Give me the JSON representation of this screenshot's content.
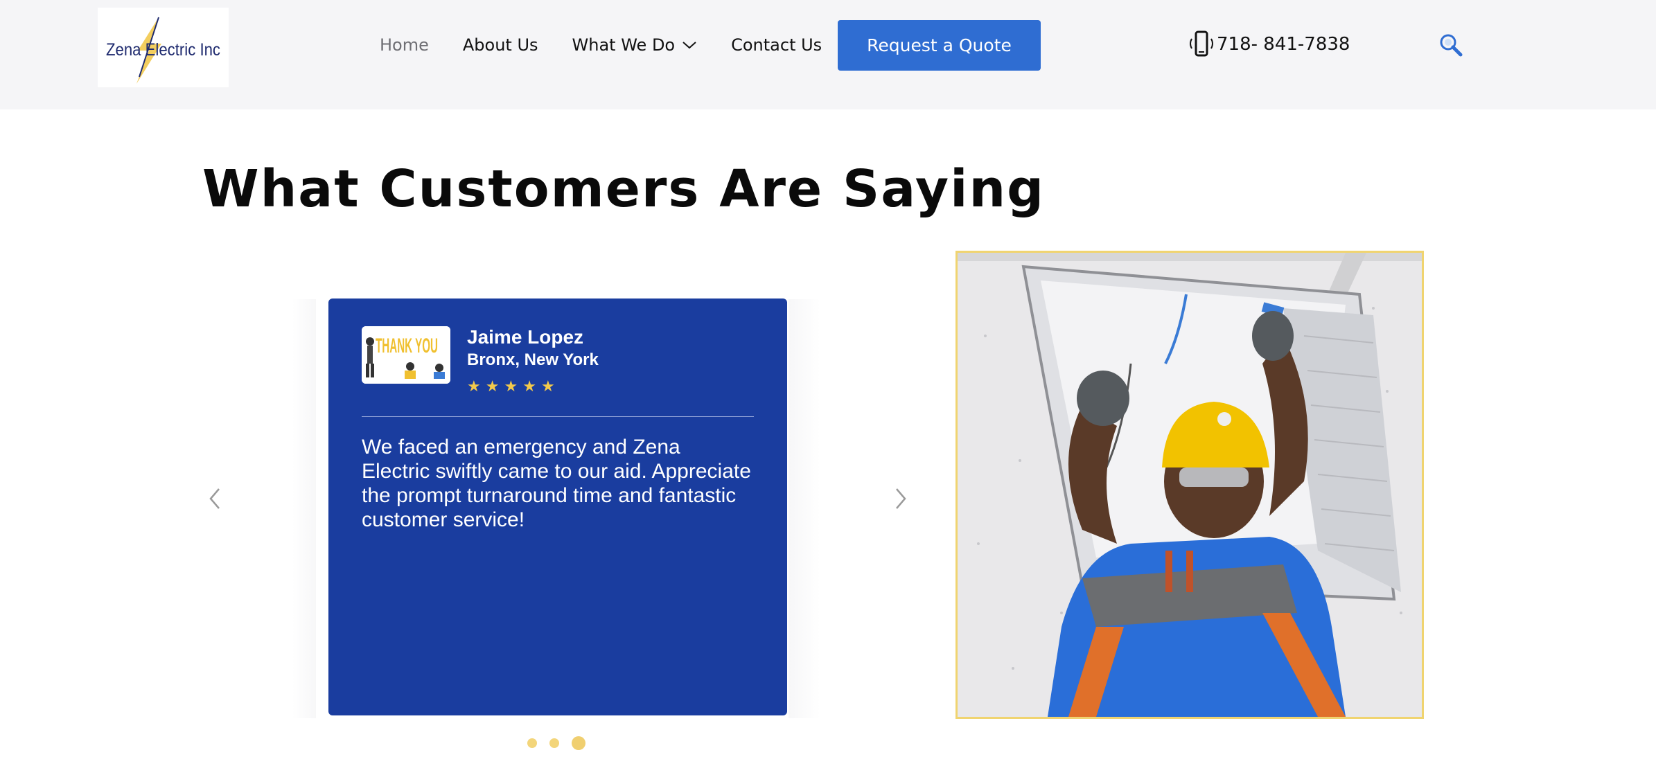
{
  "header": {
    "logo_text": "Zena Electric Inc",
    "nav": [
      {
        "label": "Home",
        "active": true
      },
      {
        "label": "About Us"
      },
      {
        "label": "What We Do",
        "has_dropdown": true
      },
      {
        "label": "Contact Us"
      }
    ],
    "cta_label": "Request a Quote",
    "phone": "718- 841-7838",
    "icons": {
      "phone": "phone-icon",
      "search": "search-icon",
      "dropdown": "chevron-down-icon"
    }
  },
  "section": {
    "title": "What Customers Are Saying"
  },
  "testimonial": {
    "avatar_text": "THANK YOU",
    "name": "Jaime Lopez",
    "location": "Bronx, New York",
    "rating": 5,
    "text": "We faced an emergency and Zena Electric swiftly came to our aid.  Appreciate the prompt turnaround time and fantastic customer service!"
  },
  "slider": {
    "slides": 3,
    "active_slide": 3
  },
  "colors": {
    "header_bg": "#f5f5f7",
    "cta_bg": "#2f6dd2",
    "card_bg": "#1a3d9f",
    "star": "#f2c94c",
    "photo_border": "#f0d470"
  }
}
